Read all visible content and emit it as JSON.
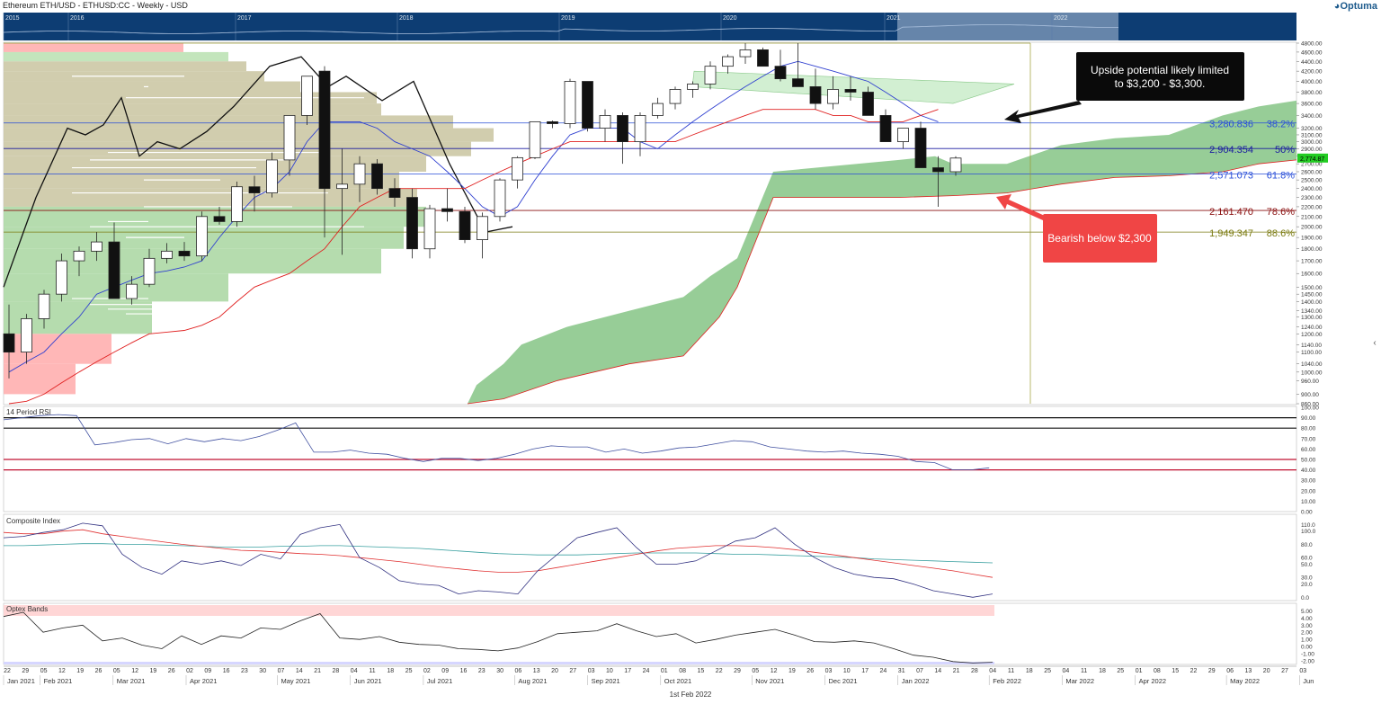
{
  "header": {
    "title": "Ethereum ETH/USD - ETHUSD:CC - Weekly - USD",
    "logo": "Optuma",
    "collapse_icon": "chevron-left-icon"
  },
  "navigator": {
    "years": [
      "2015",
      "2016",
      "2017",
      "2018",
      "2019",
      "2020",
      "2021",
      "2022"
    ]
  },
  "colors": {
    "up_candle": "#ffffff",
    "down_candle": "#111111",
    "kumo": "#8cc88c",
    "tenkan": "#3040d0",
    "kijun": "#e02020",
    "price_label": "#22cc22"
  },
  "annotations": {
    "upside": "Upside potential likely limited to $3,200 - $3,300.",
    "bearish": "Bearish below $2,300"
  },
  "panels": {
    "rsi": "14 Period RSI",
    "composite": "Composite Index",
    "optex": "Optex Bands"
  },
  "x_axis": {
    "days": [
      "22",
      "29",
      "05",
      "12",
      "19",
      "26",
      "05",
      "12",
      "19",
      "26",
      "02",
      "09",
      "16",
      "23",
      "30",
      "07",
      "14",
      "21",
      "28",
      "04",
      "11",
      "18",
      "25",
      "02",
      "09",
      "16",
      "23",
      "30",
      "06",
      "13",
      "20",
      "27",
      "03",
      "10",
      "17",
      "24",
      "01",
      "08",
      "15",
      "22",
      "29",
      "05",
      "12",
      "19",
      "26",
      "03",
      "10",
      "17",
      "24",
      "31",
      "07",
      "14",
      "21",
      "28",
      "04",
      "11",
      "18",
      "25",
      "04",
      "11",
      "18",
      "25",
      "01",
      "08",
      "15",
      "22",
      "29",
      "06",
      "13",
      "20",
      "27",
      "03"
    ],
    "months": [
      {
        "label": "Jan 2021",
        "i": 0
      },
      {
        "label": "Feb 2021",
        "i": 2
      },
      {
        "label": "Mar 2021",
        "i": 6
      },
      {
        "label": "Apr 2021",
        "i": 10
      },
      {
        "label": "May 2021",
        "i": 15
      },
      {
        "label": "Jun 2021",
        "i": 19
      },
      {
        "label": "Jul 2021",
        "i": 23
      },
      {
        "label": "Aug 2021",
        "i": 28
      },
      {
        "label": "Sep 2021",
        "i": 32
      },
      {
        "label": "Oct 2021",
        "i": 36
      },
      {
        "label": "Nov 2021",
        "i": 41
      },
      {
        "label": "Dec 2021",
        "i": 45
      },
      {
        "label": "Jan 2022",
        "i": 49
      },
      {
        "label": "Feb 2022",
        "i": 54
      },
      {
        "label": "Mar 2022",
        "i": 58
      },
      {
        "label": "Apr 2022",
        "i": 62
      },
      {
        "label": "May 2022",
        "i": 67
      },
      {
        "label": "Jun",
        "i": 71
      }
    ],
    "footer": "1st Feb 2022"
  },
  "chart_data": {
    "type": "candlestick",
    "y_scale": "log",
    "ylim": [
      860,
      4800
    ],
    "y_ticks": [
      4800,
      4600,
      4400,
      4200,
      4000,
      3800,
      3600,
      3400,
      3200,
      3100,
      3000,
      2900,
      2800,
      2700,
      2600,
      2500,
      2400,
      2300,
      2200,
      2100,
      2000,
      1900,
      1800,
      1700,
      1600,
      1500,
      1450,
      1400,
      1340,
      1300,
      1240,
      1200,
      1140,
      1100,
      1040,
      1000,
      960,
      900,
      860
    ],
    "y_tick_labels": [
      "4800.00",
      "4600.00",
      "4400.00",
      "4200.00",
      "4000.00",
      "3800.00",
      "3600.00",
      "3400.00",
      "3200.00",
      "3100.00",
      "3000.00",
      "2900.00",
      "2800.00",
      "2700.00",
      "2600.00",
      "2500.00",
      "2400.00",
      "2300.00",
      "2200.00",
      "2100.00",
      "2000.00",
      "1900.00",
      "1800.00",
      "1700.00",
      "1600.00",
      "1500.00",
      "1450.00",
      "1400.00",
      "1340.00",
      "1300.00",
      "1240.00",
      "1200.00",
      "1140.00",
      "1100.00",
      "1040.00",
      "1000.00",
      "960.00",
      "900.00",
      "860.00"
    ],
    "last_price": "2,774.87",
    "last_price_value": 2774.87,
    "fib_levels": [
      {
        "value": 3280.836,
        "label": "3,280.836",
        "pct": "38.2%",
        "color": "#2a4fd8"
      },
      {
        "value": 2904.354,
        "label": "2,904.354",
        "pct": "50%",
        "color": "#1a1aa0"
      },
      {
        "value": 2571.073,
        "label": "2,571.073",
        "pct": "61.8%",
        "color": "#2a4fd8"
      },
      {
        "value": 2161.47,
        "label": "2,161.470",
        "pct": "78.6%",
        "color": "#8a1010"
      },
      {
        "value": 1949.347,
        "label": "1,949.347",
        "pct": "88.6%",
        "color": "#7a7a10"
      }
    ],
    "candles": [
      [
        1200,
        1380,
        970,
        1100
      ],
      [
        1100,
        1320,
        1040,
        1290
      ],
      [
        1290,
        1480,
        1230,
        1450
      ],
      [
        1450,
        1760,
        1400,
        1700
      ],
      [
        1700,
        1820,
        1580,
        1780
      ],
      [
        1780,
        1950,
        1700,
        1860
      ],
      [
        1860,
        2040,
        1420,
        1420
      ],
      [
        1420,
        1580,
        1380,
        1520
      ],
      [
        1520,
        1800,
        1500,
        1720
      ],
      [
        1720,
        1850,
        1680,
        1780
      ],
      [
        1780,
        1860,
        1700,
        1740
      ],
      [
        1740,
        2150,
        1700,
        2100
      ],
      [
        2100,
        2200,
        2020,
        2050
      ],
      [
        2050,
        2480,
        2000,
        2420
      ],
      [
        2420,
        2550,
        2150,
        2350
      ],
      [
        2350,
        2850,
        2300,
        2750
      ],
      [
        2750,
        3300,
        2550,
        3400
      ],
      [
        3400,
        4100,
        3250,
        4100
      ],
      [
        4200,
        4300,
        1900,
        2400
      ],
      [
        2400,
        2900,
        1750,
        2450
      ],
      [
        2450,
        2800,
        2250,
        2700
      ],
      [
        2700,
        2760,
        2330,
        2400
      ],
      [
        2400,
        2520,
        2200,
        2300
      ],
      [
        2300,
        2400,
        1720,
        1800
      ],
      [
        1800,
        2220,
        1720,
        2180
      ],
      [
        2180,
        2400,
        2050,
        2150
      ],
      [
        2150,
        2200,
        1850,
        1880
      ],
      [
        1880,
        2140,
        1720,
        2100
      ],
      [
        2100,
        2520,
        2050,
        2500
      ],
      [
        2500,
        2800,
        2400,
        2780
      ],
      [
        2780,
        3300,
        2760,
        3300
      ],
      [
        3300,
        3320,
        3200,
        3270
      ],
      [
        3270,
        4050,
        3200,
        4000
      ],
      [
        4000,
        4000,
        3150,
        3200
      ],
      [
        3200,
        3500,
        3000,
        3400
      ],
      [
        3400,
        3450,
        2700,
        3000
      ],
      [
        3000,
        3450,
        2800,
        3400
      ],
      [
        3400,
        3700,
        3350,
        3600
      ],
      [
        3600,
        3900,
        3500,
        3850
      ],
      [
        3850,
        4000,
        3700,
        3950
      ],
      [
        3950,
        4400,
        3850,
        4300
      ],
      [
        4300,
        4550,
        4150,
        4500
      ],
      [
        4500,
        4800,
        4350,
        4650
      ],
      [
        4650,
        4700,
        4300,
        4300
      ],
      [
        4300,
        4650,
        4000,
        4050
      ],
      [
        4050,
        4800,
        3900,
        3900
      ],
      [
        3900,
        4250,
        3500,
        3600
      ],
      [
        3600,
        4100,
        3500,
        3850
      ],
      [
        3850,
        4100,
        3650,
        3800
      ],
      [
        3800,
        3900,
        3600,
        3400
      ],
      [
        3400,
        3500,
        3000,
        3000
      ],
      [
        3000,
        3200,
        2900,
        3200
      ],
      [
        3200,
        3300,
        2650,
        2650
      ],
      [
        2650,
        2800,
        2200,
        2600
      ],
      [
        2600,
        2800,
        2550,
        2775
      ]
    ],
    "tenkan": [
      1000,
      1050,
      1100,
      1200,
      1300,
      1450,
      1500,
      1550,
      1600,
      1620,
      1650,
      1700,
      1900,
      2100,
      2300,
      2400,
      2600,
      3000,
      3300,
      3300,
      3300,
      3200,
      3000,
      2900,
      2800,
      2600,
      2400,
      2200,
      2100,
      2200,
      2500,
      2800,
      3100,
      3200,
      3200,
      3200,
      3000,
      2900,
      3100,
      3300,
      3500,
      3700,
      3900,
      4100,
      4300,
      4400,
      4300,
      4200,
      4100,
      4000,
      3800,
      3600,
      3400,
      3300
    ],
    "kijun": [
      860,
      870,
      900,
      950,
      1000,
      1050,
      1100,
      1150,
      1200,
      1210,
      1220,
      1250,
      1300,
      1400,
      1500,
      1550,
      1600,
      1700,
      1800,
      2000,
      2200,
      2300,
      2400,
      2400,
      2400,
      2400,
      2400,
      2500,
      2600,
      2700,
      2800,
      2900,
      3000,
      3000,
      3000,
      3000,
      3000,
      3000,
      3000,
      3100,
      3200,
      3300,
      3400,
      3500,
      3500,
      3500,
      3500,
      3400,
      3400,
      3300,
      3300,
      3300,
      3400,
      3500
    ],
    "rsi": [
      88,
      90,
      92,
      93,
      92,
      64,
      66,
      69,
      70,
      65,
      70,
      67,
      70,
      68,
      72,
      78,
      85,
      57,
      57,
      59,
      56,
      55,
      51,
      48,
      51,
      51,
      49,
      51,
      55,
      60,
      63,
      62,
      62,
      57,
      60,
      56,
      58,
      61,
      62,
      65,
      68,
      67,
      62,
      60,
      58,
      57,
      58,
      56,
      55,
      53,
      48,
      47,
      40,
      40,
      42
    ],
    "rsi_levels": [
      90,
      80,
      50,
      40
    ],
    "composite": [
      90,
      92,
      98,
      102,
      112,
      108,
      65,
      45,
      35,
      55,
      50,
      55,
      48,
      65,
      58,
      95,
      105,
      110,
      60,
      45,
      25,
      20,
      18,
      5,
      10,
      8,
      5,
      40,
      65,
      90,
      98,
      105,
      75,
      50,
      50,
      55,
      70,
      85,
      90,
      105,
      80,
      60,
      45,
      35,
      30,
      28,
      20,
      10,
      5,
      0,
      5
    ],
    "composite_fast": [
      98,
      96,
      96,
      100,
      102,
      96,
      92,
      88,
      84,
      80,
      77,
      74,
      71,
      70,
      68,
      66,
      65,
      63,
      60,
      57,
      54,
      50,
      46,
      43,
      40,
      38,
      38,
      40,
      45,
      50,
      55,
      60,
      65,
      70,
      74,
      76,
      78,
      78,
      77,
      75,
      72,
      68,
      64,
      60,
      56,
      52,
      48,
      44,
      40,
      35,
      30
    ],
    "composite_slow": [
      78,
      78,
      79,
      80,
      81,
      81,
      80,
      80,
      79,
      78,
      77,
      76,
      76,
      76,
      77,
      77,
      78,
      78,
      77,
      76,
      75,
      74,
      72,
      70,
      68,
      66,
      65,
      64,
      64,
      64,
      65,
      66,
      67,
      67,
      67,
      67,
      66,
      65,
      65,
      64,
      63,
      62,
      61,
      60,
      58,
      57,
      56,
      55,
      54,
      53,
      52
    ],
    "optex": [
      4.2,
      4.8,
      2.0,
      2.6,
      3.0,
      0.8,
      1.2,
      0.2,
      -0.3,
      1.5,
      0.3,
      1.5,
      1.2,
      2.6,
      2.4,
      3.6,
      4.6,
      1.2,
      1.0,
      1.4,
      0.6,
      0.3,
      0.2,
      -0.3,
      -0.4,
      -0.6,
      -0.2,
      0.7,
      1.8,
      2.0,
      2.2,
      3.2,
      2.2,
      1.4,
      1.8,
      0.5,
      1.0,
      1.6,
      2.0,
      2.4,
      1.6,
      0.7,
      0.6,
      0.8,
      0.5,
      -0.3,
      -1.2,
      -1.5,
      -2.1,
      -2.3,
      -2.2
    ],
    "rsi_ticks": [
      "100.00",
      "90.00",
      "80.00",
      "70.00",
      "60.00",
      "50.00",
      "40.00",
      "30.00",
      "20.00",
      "10.00",
      "0.00"
    ],
    "composite_ticks": [
      {
        "v": 110,
        "t": "110.0"
      },
      {
        "v": 100,
        "t": "100.0"
      },
      {
        "v": 80,
        "t": "80.0"
      },
      {
        "v": 60,
        "t": "60.0"
      },
      {
        "v": 50,
        "t": "50.0"
      },
      {
        "v": 30,
        "t": "30.0"
      },
      {
        "v": 20,
        "t": "20.0"
      },
      {
        "v": 0,
        "t": "0.0"
      }
    ],
    "optex_ticks": [
      {
        "v": 5,
        "t": "5.00"
      },
      {
        "v": 4,
        "t": "4.00"
      },
      {
        "v": 3,
        "t": "3.00"
      },
      {
        "v": 2,
        "t": "2.00"
      },
      {
        "v": 1,
        "t": "1.00"
      },
      {
        "v": 0,
        "t": "0.00"
      },
      {
        "v": -1,
        "t": "-1.00"
      },
      {
        "v": -2,
        "t": "-2.00"
      }
    ]
  }
}
